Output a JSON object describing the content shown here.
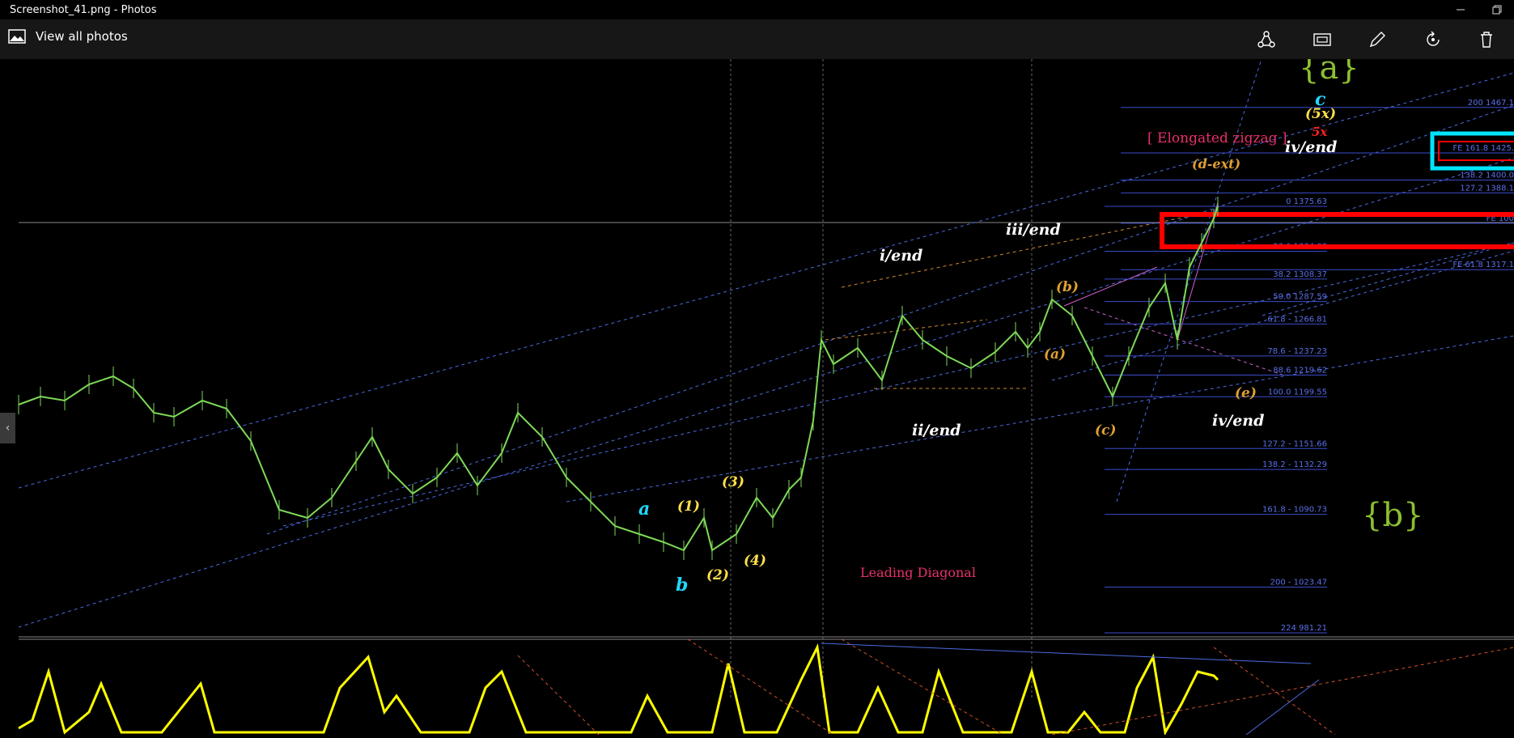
{
  "window": {
    "title": "Screenshot_41.png - Photos",
    "minimize_icon": "minimize-icon",
    "restore_icon": "restore-icon"
  },
  "toolbar": {
    "view_all_label": "View all photos",
    "icons": [
      "share-icon",
      "slideshow-icon",
      "edit-icon",
      "rotate-icon",
      "delete-icon"
    ]
  },
  "chart": {
    "labels": {
      "a_brace": "{a}",
      "b_brace": "{b}",
      "elongated": "[ Elongated zigzag ]",
      "leading": "Leading Diagonal",
      "i_end": "i/end",
      "ii_end": "ii/end",
      "iii_end": "iii/end",
      "iv_end_top": "iv/end",
      "iv_end_bottom": "iv/end",
      "d_ext": "(d-ext)",
      "five_x_y": "(5x)",
      "five_x_r": "5x",
      "c_cyan": "c",
      "a_cyan": "a",
      "b_cyan": "b",
      "w1": "(1)",
      "w2": "(2)",
      "w3": "(3)",
      "w4": "(4)",
      "wa": "(a)",
      "wb": "(b)",
      "wc": "(c)",
      "we": "(e)"
    },
    "fib_levels": [
      {
        "label": "0 1375.63",
        "price": 1375.63
      },
      {
        "label": "23.6 1334.08",
        "price": 1334.08
      },
      {
        "label": "38.2 1308.37",
        "price": 1308.37
      },
      {
        "label": "50.0 1287.59",
        "price": 1287.59
      },
      {
        "label": "61.8 - 1266.81",
        "price": 1266.81
      },
      {
        "label": "78.6 - 1237.23",
        "price": 1237.23
      },
      {
        "label": "88.6 1219.62",
        "price": 1219.62
      },
      {
        "label": "100.0 1199.55",
        "price": 1199.55
      },
      {
        "label": "127.2 - 1151.66",
        "price": 1151.66
      },
      {
        "label": "138.2 - 1132.29",
        "price": 1132.29
      },
      {
        "label": "161.8 - 1090.73",
        "price": 1090.73
      },
      {
        "label": "200 - 1023.47",
        "price": 1023.47
      },
      {
        "label": "224 981.21",
        "price": 981.21
      }
    ],
    "fe_levels": [
      {
        "label": "200 1467.1",
        "price": 1467.1
      },
      {
        "label": "FE 161.8 1425.",
        "price": 1425
      },
      {
        "label": "138.2 1400.0",
        "price": 1400.0
      },
      {
        "label": "127.2 1388.1",
        "price": 1388.1
      },
      {
        "label": "FE 100",
        "price": 1360
      },
      {
        "label": "FE 61.8 1317.1",
        "price": 1317.1
      }
    ],
    "colors": {
      "candles": "#7ed957",
      "oscillator": "#ffff00",
      "fib": "#3a4dcc",
      "highlight_red": "#ff0000",
      "highlight_cyan": "#00e5ff"
    }
  }
}
